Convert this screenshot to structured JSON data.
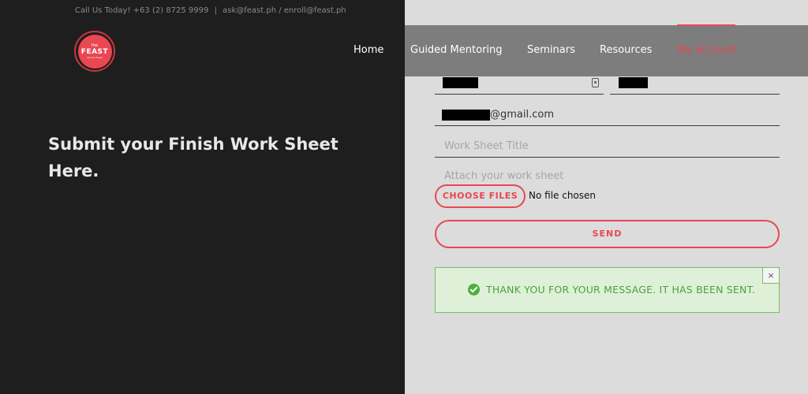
{
  "topbar": {
    "call": "Call Us Today! +63 (2) 8725 9999",
    "divider": "|",
    "emails": "ask@feast.ph / enroll@feast.ph"
  },
  "logo": {
    "the": "the",
    "word": "FEAST",
    "sub": "Church Feast"
  },
  "nav": {
    "items": [
      {
        "label": "Home"
      },
      {
        "label": "Guided Mentoring"
      },
      {
        "label": "Seminars"
      },
      {
        "label": "Resources"
      },
      {
        "label": "My Account"
      }
    ],
    "active_color": "#e94751"
  },
  "hero": {
    "title": "Submit your Finish Work Sheet Here."
  },
  "form": {
    "email_suffix": "@gmail.com",
    "title_placeholder": "Work Sheet Title",
    "attach_label": "Attach your work sheet",
    "choose_files_label": "CHOOSE FILES",
    "no_file_text": "No file chosen",
    "send_label": "SEND"
  },
  "alert": {
    "message": "THANK YOU FOR YOUR MESSAGE. IT HAS BEEN SENT.",
    "close_symbol": "×",
    "icon": "check-circle-icon",
    "color": "#4ca13d"
  },
  "colors": {
    "accent": "#e94751",
    "dark_bg": "#1e1e1e",
    "form_bg": "#dcdcdc"
  }
}
